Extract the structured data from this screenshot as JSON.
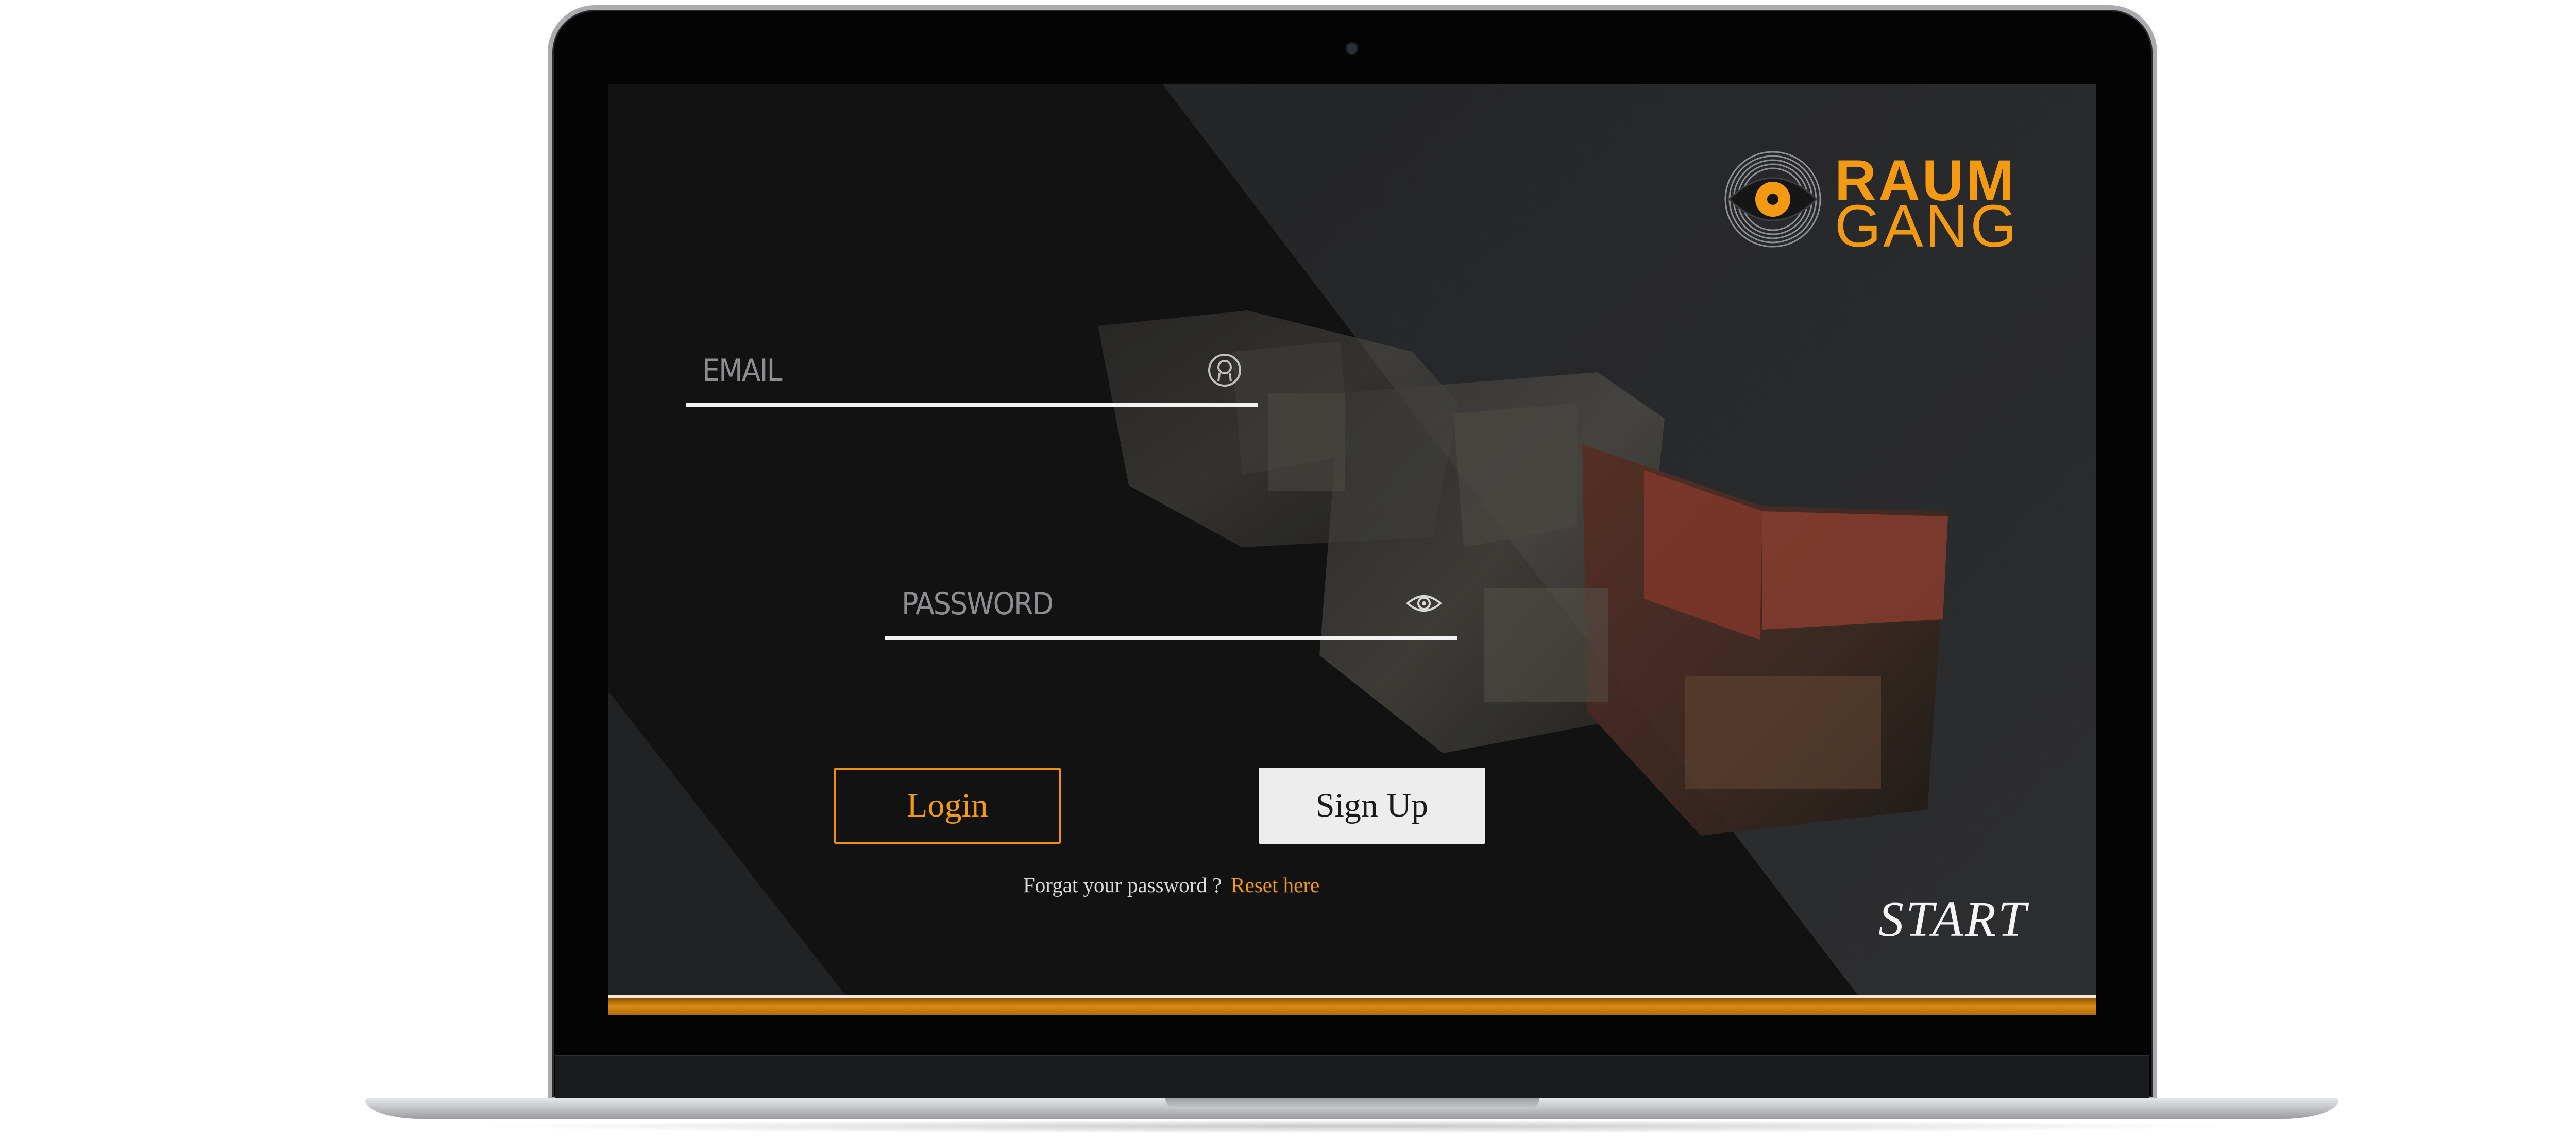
{
  "brand": {
    "line1": "RAUM",
    "line2": "GANG",
    "logo_icon": "eye-disc-icon",
    "accent_color": "#f39a12"
  },
  "login_form": {
    "email_placeholder": "EMAIL",
    "email_icon": "user-icon",
    "password_placeholder": "PASSWORD",
    "password_icon": "eye-icon",
    "login_label": "Login",
    "signup_label": "Sign Up",
    "forgot_text": "Forgat your password ?",
    "reset_link": "Reset here"
  },
  "start_label": "START",
  "colors": {
    "screen_bg": "#151617",
    "bar": "#d88c15",
    "button_light": "#ededed"
  }
}
